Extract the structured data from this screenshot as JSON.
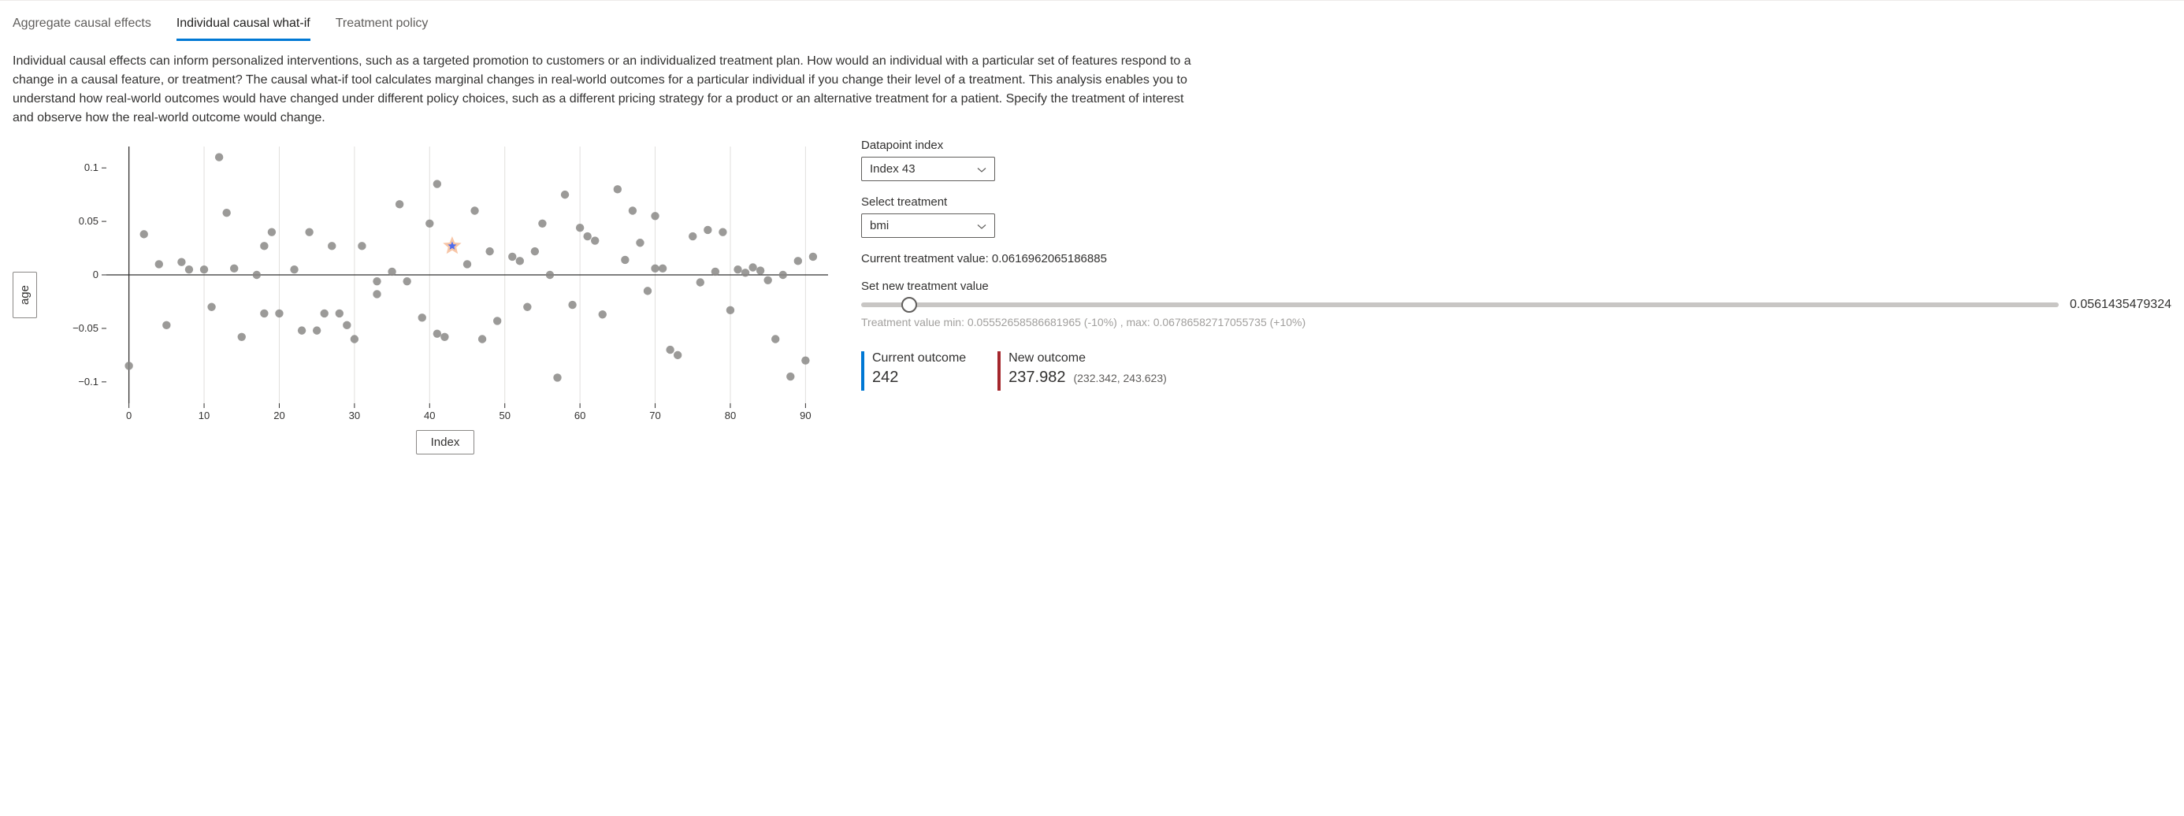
{
  "tabs": {
    "aggregate": "Aggregate causal effects",
    "individual": "Individual causal what-if",
    "policy": "Treatment policy"
  },
  "active_tab": "individual",
  "description": "Individual causal effects can inform personalized interventions, such as a targeted promotion to customers or an individualized treatment plan. How would an individual with a particular set of features respond to a change in a causal feature, or treatment? The causal what-if tool calculates marginal changes in real-world outcomes for a particular individual if you change their level of a treatment. This analysis enables you to understand how real-world outcomes would have changed under different policy choices, such as a different pricing strategy for a product or an alternative treatment for a patient. Specify the treatment of interest and observe how the real-world outcome would change.",
  "chart_data": {
    "type": "scatter",
    "xlabel": "Index",
    "ylabel": "age",
    "xlim": [
      -3,
      93
    ],
    "ylim": [
      -0.12,
      0.12
    ],
    "xticks": [
      0,
      10,
      20,
      30,
      40,
      50,
      60,
      70,
      80,
      90
    ],
    "yticks": [
      -0.1,
      -0.05,
      0,
      0.05,
      0.1
    ],
    "selected_index": 43,
    "selected_y": 0.027,
    "points": [
      {
        "x": 0,
        "y": -0.085
      },
      {
        "x": 2,
        "y": 0.038
      },
      {
        "x": 4,
        "y": 0.01
      },
      {
        "x": 5,
        "y": -0.047
      },
      {
        "x": 7,
        "y": 0.012
      },
      {
        "x": 8,
        "y": 0.005
      },
      {
        "x": 10,
        "y": 0.005
      },
      {
        "x": 11,
        "y": -0.03
      },
      {
        "x": 12,
        "y": 0.11
      },
      {
        "x": 13,
        "y": 0.058
      },
      {
        "x": 14,
        "y": 0.006
      },
      {
        "x": 15,
        "y": -0.058
      },
      {
        "x": 17,
        "y": 0.0
      },
      {
        "x": 18,
        "y": 0.027
      },
      {
        "x": 18,
        "y": -0.036
      },
      {
        "x": 19,
        "y": 0.04
      },
      {
        "x": 20,
        "y": -0.036
      },
      {
        "x": 22,
        "y": 0.005
      },
      {
        "x": 23,
        "y": -0.052
      },
      {
        "x": 24,
        "y": 0.04
      },
      {
        "x": 25,
        "y": -0.052
      },
      {
        "x": 26,
        "y": -0.036
      },
      {
        "x": 27,
        "y": 0.027
      },
      {
        "x": 28,
        "y": -0.036
      },
      {
        "x": 29,
        "y": -0.047
      },
      {
        "x": 30,
        "y": -0.06
      },
      {
        "x": 31,
        "y": 0.027
      },
      {
        "x": 33,
        "y": -0.018
      },
      {
        "x": 33,
        "y": -0.006
      },
      {
        "x": 35,
        "y": 0.003
      },
      {
        "x": 36,
        "y": 0.066
      },
      {
        "x": 37,
        "y": -0.006
      },
      {
        "x": 39,
        "y": -0.04
      },
      {
        "x": 40,
        "y": 0.048
      },
      {
        "x": 41,
        "y": 0.085
      },
      {
        "x": 41,
        "y": -0.055
      },
      {
        "x": 42,
        "y": -0.058
      },
      {
        "x": 43,
        "y": 0.027
      },
      {
        "x": 45,
        "y": 0.01
      },
      {
        "x": 46,
        "y": 0.06
      },
      {
        "x": 47,
        "y": -0.06
      },
      {
        "x": 48,
        "y": 0.022
      },
      {
        "x": 49,
        "y": -0.043
      },
      {
        "x": 51,
        "y": 0.017
      },
      {
        "x": 52,
        "y": 0.013
      },
      {
        "x": 53,
        "y": -0.03
      },
      {
        "x": 54,
        "y": 0.022
      },
      {
        "x": 55,
        "y": 0.048
      },
      {
        "x": 56,
        "y": 0.0
      },
      {
        "x": 57,
        "y": -0.096
      },
      {
        "x": 58,
        "y": 0.075
      },
      {
        "x": 59,
        "y": -0.028
      },
      {
        "x": 60,
        "y": 0.044
      },
      {
        "x": 61,
        "y": 0.036
      },
      {
        "x": 62,
        "y": 0.032
      },
      {
        "x": 63,
        "y": -0.037
      },
      {
        "x": 65,
        "y": 0.08
      },
      {
        "x": 66,
        "y": 0.014
      },
      {
        "x": 67,
        "y": 0.06
      },
      {
        "x": 68,
        "y": 0.03
      },
      {
        "x": 69,
        "y": -0.015
      },
      {
        "x": 70,
        "y": 0.055
      },
      {
        "x": 70,
        "y": 0.006
      },
      {
        "x": 71,
        "y": 0.006
      },
      {
        "x": 72,
        "y": -0.07
      },
      {
        "x": 73,
        "y": -0.075
      },
      {
        "x": 75,
        "y": 0.036
      },
      {
        "x": 76,
        "y": -0.007
      },
      {
        "x": 77,
        "y": 0.042
      },
      {
        "x": 78,
        "y": 0.003
      },
      {
        "x": 79,
        "y": 0.04
      },
      {
        "x": 80,
        "y": -0.033
      },
      {
        "x": 81,
        "y": 0.005
      },
      {
        "x": 82,
        "y": 0.002
      },
      {
        "x": 83,
        "y": 0.007
      },
      {
        "x": 84,
        "y": 0.004
      },
      {
        "x": 85,
        "y": -0.005
      },
      {
        "x": 86,
        "y": -0.06
      },
      {
        "x": 87,
        "y": 0.0
      },
      {
        "x": 88,
        "y": -0.095
      },
      {
        "x": 89,
        "y": 0.013
      },
      {
        "x": 90,
        "y": -0.08
      },
      {
        "x": 91,
        "y": 0.017
      }
    ]
  },
  "controls": {
    "datapoint_label": "Datapoint index",
    "datapoint_value": "Index 43",
    "treatment_label": "Select treatment",
    "treatment_value": "bmi",
    "current_treatment_label": "Current treatment value:",
    "current_treatment_value": "0.0616962065186885",
    "set_new_label": "Set new treatment value",
    "slider_value": "0.0561435479324",
    "slider_percent": 4,
    "hint": "Treatment value min: 0.05552658586681965 (-10%) , max: 0.06786582717055735 (+10%)",
    "current_outcome_label": "Current outcome",
    "current_outcome_value": "242",
    "new_outcome_label": "New outcome",
    "new_outcome_value": "237.982",
    "new_outcome_ci": "(232.342, 243.623)"
  }
}
